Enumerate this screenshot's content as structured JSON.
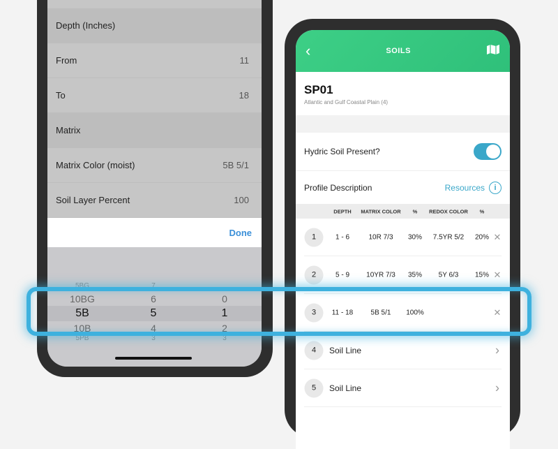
{
  "left": {
    "rows": [
      {
        "label": "Depth (Inches)",
        "value": "",
        "header": true
      },
      {
        "label": "From",
        "value": "11"
      },
      {
        "label": "To",
        "value": "18"
      },
      {
        "label": "Matrix",
        "value": "",
        "header": true
      },
      {
        "label": "Matrix Color (moist)",
        "value": "5B 5/1"
      },
      {
        "label": "Soil Layer Percent",
        "value": "100"
      }
    ],
    "done": "Done",
    "picker": {
      "hue": [
        "5BG",
        "10BG",
        "5B",
        "10B",
        "5PB"
      ],
      "value": [
        "7",
        "6",
        "5",
        "4",
        "3"
      ],
      "chroma": [
        "",
        "0",
        "1",
        "2",
        "3"
      ]
    }
  },
  "right": {
    "title": "SOILS",
    "plot": "SP01",
    "region": "Atlantic and Gulf Coastal Plain (4)",
    "hydric_label": "Hydric Soil Present?",
    "hydric_on": true,
    "profile_label": "Profile Description",
    "resources": "Resources",
    "columns": [
      "DEPTH",
      "MATRIX COLOR",
      "%",
      "REDOX COLOR",
      "%"
    ],
    "rows": [
      {
        "n": "1",
        "depth": "1 - 6",
        "matrix": "10R 7/3",
        "mp": "30%",
        "redox": "7.5YR 5/2",
        "rp": "20%"
      },
      {
        "n": "2",
        "depth": "5 - 9",
        "matrix": "10YR 7/3",
        "mp": "35%",
        "redox": "5Y 6/3",
        "rp": "15%"
      },
      {
        "n": "3",
        "depth": "11 - 18",
        "matrix": "5B 5/1",
        "mp": "100%",
        "redox": "",
        "rp": ""
      }
    ],
    "lines": [
      {
        "n": "4",
        "label": "Soil Line"
      },
      {
        "n": "5",
        "label": "Soil Line"
      }
    ]
  },
  "colors": {
    "accent": "#3aa7c9",
    "header_green": "#34c880",
    "highlight": "#3eb1de"
  }
}
